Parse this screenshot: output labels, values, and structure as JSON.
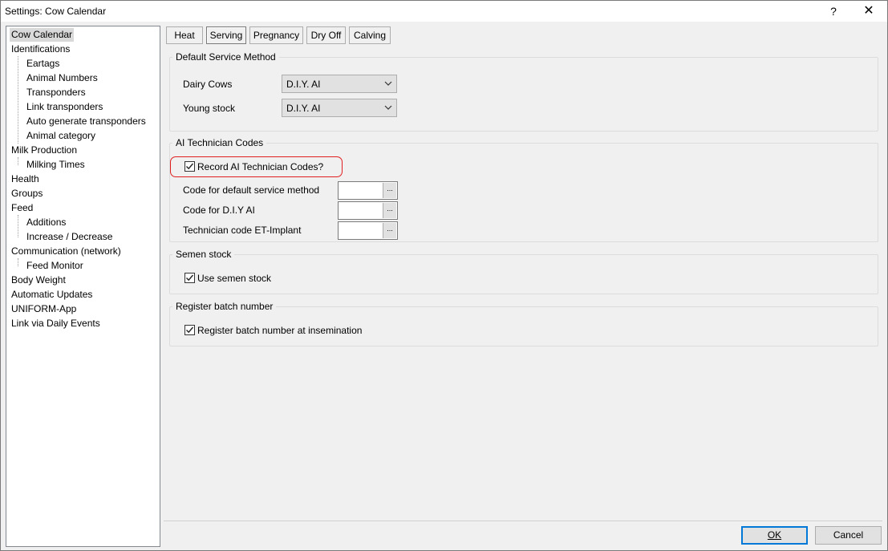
{
  "window": {
    "title": "Settings:  Cow Calendar",
    "help_symbol": "?",
    "close_symbol": "✕"
  },
  "tree": {
    "items": [
      {
        "label": "Cow Calendar",
        "level": 0,
        "selected": true
      },
      {
        "label": "Identifications",
        "level": 0
      },
      {
        "label": "Eartags",
        "level": 1
      },
      {
        "label": "Animal Numbers",
        "level": 1
      },
      {
        "label": "Transponders",
        "level": 1
      },
      {
        "label": "Link transponders",
        "level": 1
      },
      {
        "label": "Auto generate transponders",
        "level": 1
      },
      {
        "label": "Animal category",
        "level": 1
      },
      {
        "label": "Milk Production",
        "level": 0
      },
      {
        "label": "Milking Times",
        "level": 1
      },
      {
        "label": "Health",
        "level": 0
      },
      {
        "label": "Groups",
        "level": 0
      },
      {
        "label": "Feed",
        "level": 0
      },
      {
        "label": "Additions",
        "level": 1
      },
      {
        "label": "Increase / Decrease",
        "level": 1
      },
      {
        "label": "Communication (network)",
        "level": 0
      },
      {
        "label": "Feed Monitor",
        "level": 1
      },
      {
        "label": "Body Weight",
        "level": 0
      },
      {
        "label": "Automatic Updates",
        "level": 0
      },
      {
        "label": "UNIFORM-App",
        "level": 0
      },
      {
        "label": "Link via Daily Events",
        "level": 0
      }
    ]
  },
  "tabs": [
    {
      "label": "Heat",
      "active": false
    },
    {
      "label": "Serving",
      "active": true
    },
    {
      "label": "Pregnancy",
      "active": false
    },
    {
      "label": "Dry Off",
      "active": false
    },
    {
      "label": "Calving",
      "active": false
    }
  ],
  "service_method": {
    "title": "Default Service Method",
    "dairy_label": "Dairy Cows",
    "dairy_value": "D.I.Y. AI",
    "young_label": "Young stock",
    "young_value": "D.I.Y. AI"
  },
  "technician": {
    "title": "AI Technician Codes",
    "record_label": "Record AI Technician Codes?",
    "record_checked": true,
    "default_label": "Code for default service method",
    "default_value": "",
    "diy_label": "Code for D.I.Y AI",
    "diy_value": "",
    "et_label": "Technician code ET-Implant",
    "et_value": "",
    "browse_symbol": "..."
  },
  "semen": {
    "title": "Semen stock",
    "use_label": "Use semen stock",
    "use_checked": true
  },
  "batch": {
    "title": "Register batch number",
    "register_label": "Register batch number at insemination",
    "register_checked": true
  },
  "buttons": {
    "ok": "OK",
    "cancel": "Cancel"
  },
  "colors": {
    "highlight": "#e02020",
    "default_button_border": "#0078d7"
  }
}
